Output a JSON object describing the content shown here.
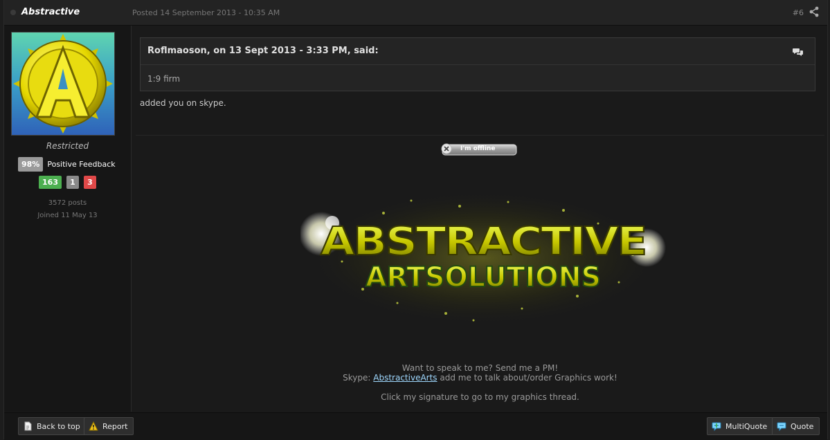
{
  "author": {
    "name": "Abstractive",
    "group": "Restricted",
    "feedback_percent": "98%",
    "feedback_label": "Positive Feedback",
    "rep_positive": "163",
    "rep_neutral": "1",
    "rep_negative": "3",
    "posts": "3572 posts",
    "joined": "Joined 11 May 13",
    "avatar_letter": "A"
  },
  "post": {
    "posted": "Posted 14 September 2013 - 10:35 AM",
    "number": "#6",
    "quote_cite": "Roflmaoson, on 13 Sept 2013 - 3:33 PM, said:",
    "quote_text": "1:9 firm",
    "text": "added you on skype."
  },
  "signature": {
    "status_badge": "I'm offline",
    "banner_line1": "ABSTRACTIVE",
    "banner_line2": "ARTSOLUTIONS",
    "line1": "Want to speak to me? Send me a PM!",
    "line2_prefix": "Skype: ",
    "line2_link": "AbstractiveArts",
    "line2_suffix": " add me to talk about/order Graphics work!",
    "line3": "Click my signature to go to my graphics thread."
  },
  "footer": {
    "back_to_top": "Back to top",
    "report": "Report",
    "multiquote": "MultiQuote",
    "quote": "Quote"
  },
  "colors": {
    "rep_positive": "#4caf50",
    "rep_neutral": "#8a8a8a",
    "rep_negative": "#e04848",
    "link": "#9fd8ff"
  },
  "icons": {
    "share": "share-icon",
    "quote": "speech-bubbles-icon",
    "status": "offline-x-icon",
    "back_to_top": "page-icon",
    "report": "warning-icon",
    "multiquote": "multiquote-bubble-icon",
    "quote_button": "quote-bubble-icon"
  }
}
